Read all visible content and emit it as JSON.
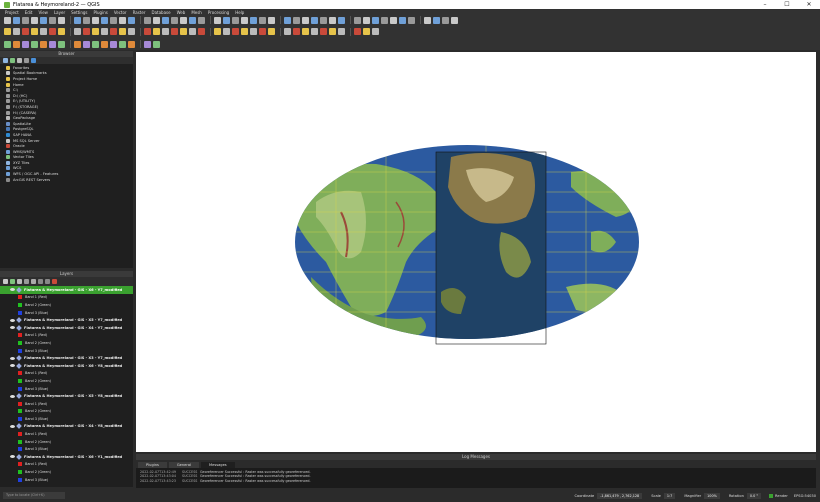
{
  "window": {
    "title": "Flatarea & Heymoreland-2 — QGIS"
  },
  "menu": [
    "Project",
    "Edit",
    "View",
    "Layer",
    "Settings",
    "Plugins",
    "Vector",
    "Raster",
    "Database",
    "Web",
    "Mesh",
    "Processing",
    "Help"
  ],
  "browser": {
    "title": "Browser",
    "items": [
      {
        "label": "Favorites",
        "icon": "star-icon",
        "color": "#e6c34a"
      },
      {
        "label": "Spatial Bookmarks",
        "icon": "bookmark-icon",
        "color": "#c9c9c9"
      },
      {
        "label": "Project Home",
        "icon": "folder-icon",
        "color": "#e6c34a"
      },
      {
        "label": "Home",
        "icon": "folder-icon",
        "color": "#e6c34a"
      },
      {
        "label": "C:\\",
        "icon": "drive-icon",
        "color": "#9a9a9a"
      },
      {
        "label": "D:\\ (HC)",
        "icon": "drive-icon",
        "color": "#9a9a9a"
      },
      {
        "label": "E:\\ (UTILITY)",
        "icon": "drive-icon",
        "color": "#9a9a9a"
      },
      {
        "label": "F:\\ (STORAGE)",
        "icon": "drive-icon",
        "color": "#9a9a9a"
      },
      {
        "label": "H:\\ (CASERA)",
        "icon": "drive-icon",
        "color": "#9a9a9a"
      },
      {
        "label": "GeoPackage",
        "icon": "geopackage-icon",
        "color": "#b9b9b9"
      },
      {
        "label": "SpatiaLite",
        "icon": "spatialite-icon",
        "color": "#6a8fc7"
      },
      {
        "label": "PostgreSQL",
        "icon": "postgresql-icon",
        "color": "#4a78b5"
      },
      {
        "label": "SAP HANA",
        "icon": "sap-hana-icon",
        "color": "#2f8ad1"
      },
      {
        "label": "MS SQL Server",
        "icon": "mssql-icon",
        "color": "#c9c9c9"
      },
      {
        "label": "Oracle",
        "icon": "oracle-icon",
        "color": "#c94a3a"
      },
      {
        "label": "WMS/WMTS",
        "icon": "wms-icon",
        "color": "#6fa0d8"
      },
      {
        "label": "Vector Tiles",
        "icon": "vector-tiles-icon",
        "color": "#7ec27e"
      },
      {
        "label": "XYZ Tiles",
        "icon": "xyz-tiles-icon",
        "color": "#8fb5e0"
      },
      {
        "label": "WCS",
        "icon": "wcs-icon",
        "color": "#6fa0d8"
      },
      {
        "label": "WFS / OGC API - Features",
        "icon": "wfs-icon",
        "color": "#6fa0d8"
      },
      {
        "label": "ArcGIS REST Servers",
        "icon": "arcgis-icon",
        "color": "#8a8a8a"
      }
    ]
  },
  "layers": {
    "title": "Layers",
    "groups": [
      {
        "name": "Flatarea & Heymoreland - GIS - X6 - Y7_modified",
        "selected": true,
        "bands": [
          "Band 1 (Red)",
          "Band 2 (Green)",
          "Band 3 (Blue)"
        ]
      },
      {
        "name": "Flatarea & Heymoreland - GIS - X5 - Y7_modified",
        "selected": false,
        "bands": []
      },
      {
        "name": "Flatarea & Heymoreland - GIS - X4 - Y7_modified",
        "selected": false,
        "bands": [
          "Band 1 (Red)",
          "Band 2 (Green)",
          "Band 3 (Blue)"
        ]
      },
      {
        "name": "Flatarea & Heymoreland - GIS - X3 - Y7_modified",
        "selected": false,
        "bands": []
      },
      {
        "name": "Flatarea & Heymoreland - GIS - X6 - Y8_modified",
        "selected": false,
        "bands": [
          "Band 1 (Red)",
          "Band 2 (Green)",
          "Band 3 (Blue)"
        ]
      },
      {
        "name": "Flatarea & Heymoreland - GIS - X5 - Y8_modified",
        "selected": false,
        "bands": [
          "Band 1 (Red)",
          "Band 2 (Green)",
          "Band 3 (Blue)"
        ]
      },
      {
        "name": "Flatarea & Heymoreland - GIS - X4 - Y8_modified",
        "selected": false,
        "bands": [
          "Band 1 (Red)",
          "Band 2 (Green)",
          "Band 3 (Blue)"
        ]
      },
      {
        "name": "Flatarea & Heymoreland - GIS - X6 - Y1_modified",
        "selected": false,
        "bands": [
          "Band 1 (Red)",
          "Band 2 (Green)",
          "Band 3 (Blue)"
        ]
      }
    ],
    "band_colors": [
      "#e02020",
      "#20c020",
      "#2040e0"
    ]
  },
  "log": {
    "title": "Log Messages",
    "tabs": [
      "Plugins",
      "General",
      "Messages"
    ],
    "active_tab": 2,
    "lines": [
      {
        "time": "2022-02-07T13:42:49",
        "level": "SUCCESS",
        "text": "Georeferencer Successful : Raster was successfully georeferenced."
      },
      {
        "time": "2022-02-07T13:43:04",
        "level": "SUCCESS",
        "text": "Georeferencer Successful : Raster was successfully georeferenced."
      },
      {
        "time": "2022-02-07T13:43:23",
        "level": "SUCCESS",
        "text": "Georeferencer Successful : Raster was successfully georeferenced."
      }
    ]
  },
  "status": {
    "locator_placeholder": "Type to locate (Ctrl+K)",
    "coordinate_label": "Coordinate",
    "coordinate_value": "-1,861,479 , 2,762,128",
    "scale_label": "Scale",
    "scale_value": "1:7",
    "magnifier_label": "Magnifier",
    "magnifier_value": "100%",
    "rotation_label": "Rotation",
    "rotation_value": "0.0 °",
    "render_label": "Render",
    "crs_label": "EPSG:54030"
  },
  "colors": {
    "selected_layer": "#3aa12f",
    "ocean": "#2c5aa0",
    "land": "#7fae5a"
  }
}
